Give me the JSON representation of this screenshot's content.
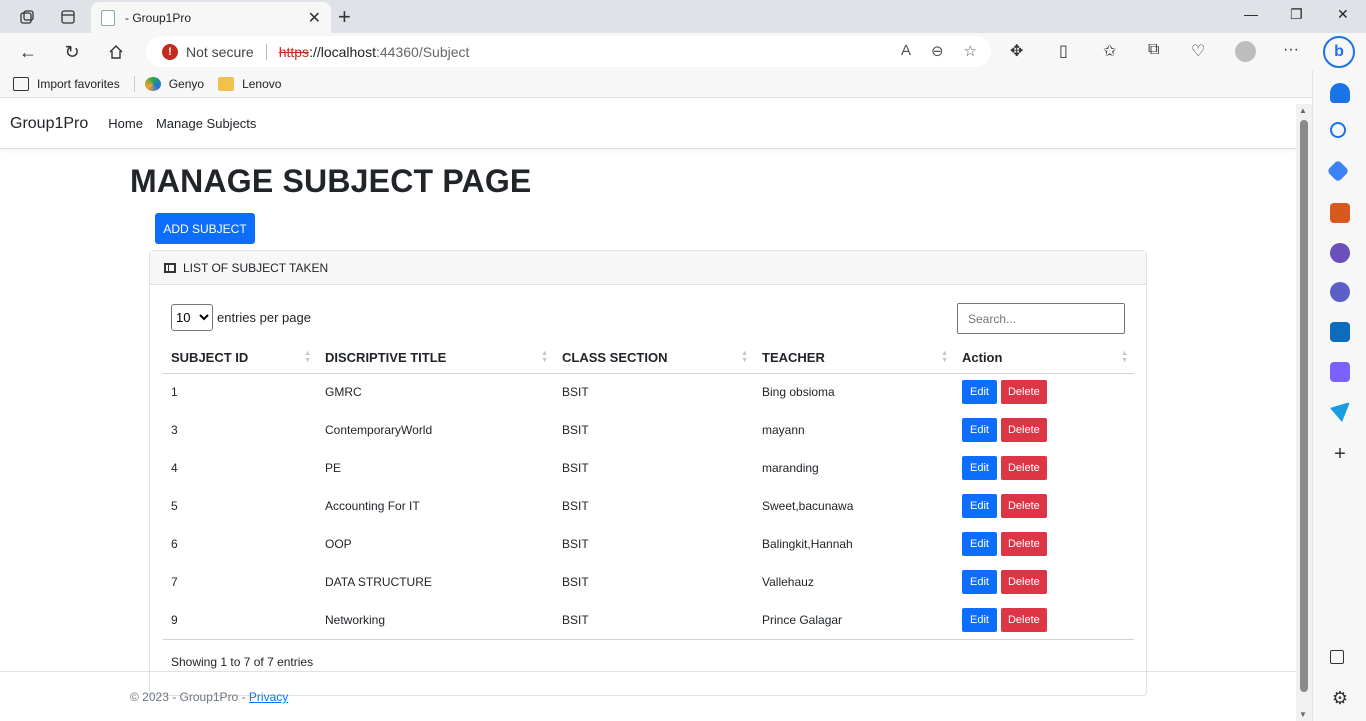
{
  "browser": {
    "tab_title": "- Group1Pro",
    "not_secure": "Not secure",
    "url_scheme": "https",
    "url_host": "://localhost",
    "url_path": ":44360/Subject",
    "favorites": [
      {
        "label": "Import favorites",
        "icon": "import-icon"
      },
      {
        "label": "Genyo",
        "icon": "genyo-icon"
      },
      {
        "label": "Lenovo",
        "icon": "folder-icon"
      }
    ]
  },
  "site": {
    "brand": "Group1Pro",
    "nav": [
      "Home",
      "Manage Subjects"
    ]
  },
  "page": {
    "title": "MANAGE SUBJECT PAGE",
    "add_button": "ADD SUBJECT",
    "card_header": "LIST OF SUBJECT TAKEN",
    "entries_value": "10",
    "entries_label": "entries per page",
    "search_placeholder": "Search...",
    "columns": [
      "SUBJECT ID",
      "DISCRIPTIVE TITLE",
      "CLASS SECTION",
      "TEACHER",
      "Action"
    ],
    "rows": [
      {
        "id": "1",
        "title": "GMRC",
        "section": "BSIT",
        "teacher": "Bing obsioma"
      },
      {
        "id": "3",
        "title": "ContemporaryWorld",
        "section": "BSIT",
        "teacher": "mayann"
      },
      {
        "id": "4",
        "title": "PE",
        "section": "BSIT",
        "teacher": "maranding"
      },
      {
        "id": "5",
        "title": "Accounting For IT",
        "section": "BSIT",
        "teacher": "Sweet,bacunawa"
      },
      {
        "id": "6",
        "title": "OOP",
        "section": "BSIT",
        "teacher": "Balingkit,Hannah"
      },
      {
        "id": "7",
        "title": "DATA STRUCTURE",
        "section": "BSIT",
        "teacher": "Vallehauz"
      },
      {
        "id": "9",
        "title": "Networking",
        "section": "BSIT",
        "teacher": "Prince Galagar"
      }
    ],
    "edit_label": "Edit",
    "delete_label": "Delete",
    "showing": "Showing 1 to 7 of 7 entries"
  },
  "footer": {
    "text": "© 2023 - Group1Pro - ",
    "privacy": "Privacy"
  },
  "colors": {
    "primary": "#0d6efd",
    "danger": "#dc3545"
  }
}
